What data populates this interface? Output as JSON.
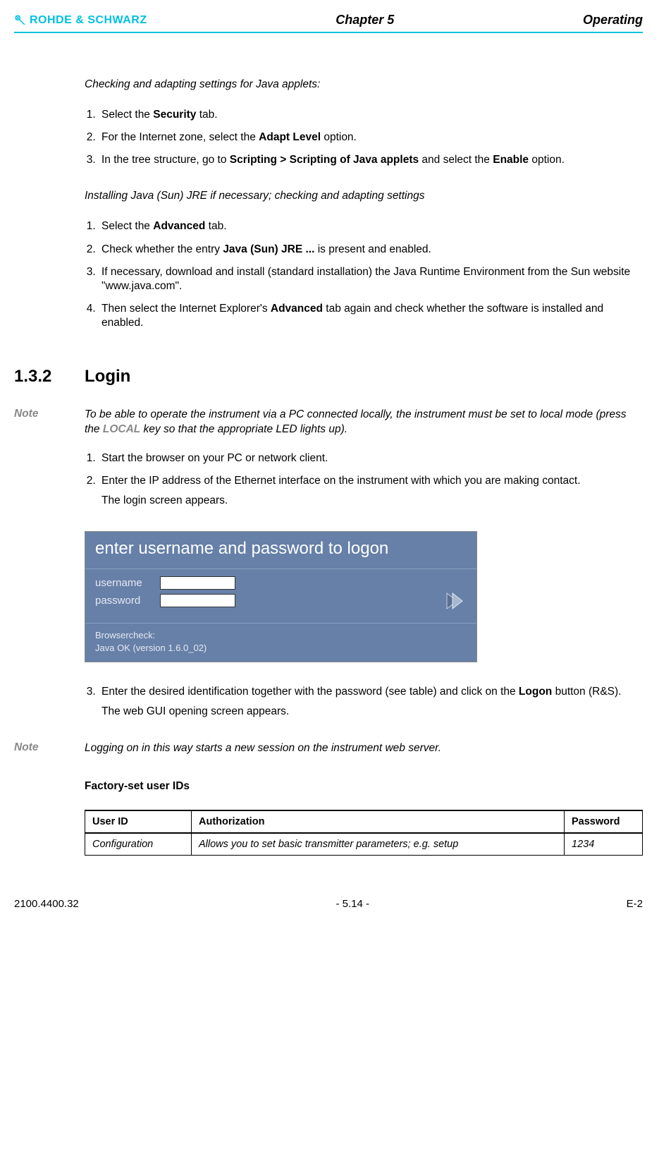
{
  "header": {
    "brand": "ROHDE & SCHWARZ",
    "chapter": "Chapter 5",
    "operating": "Operating"
  },
  "section1": {
    "heading": "Checking and adapting settings for Java applets:",
    "step1_pre": "Select the ",
    "step1_bold": "Security",
    "step1_post": " tab.",
    "step2_pre": "For the Internet zone, select the ",
    "step2_bold": "Adapt Level",
    "step2_post": " option.",
    "step3_pre": "In the tree structure, go to ",
    "step3_bold1": "Scripting > Scripting of Java applets",
    "step3_mid": " and select the ",
    "step3_bold2": "Enable",
    "step3_post": " option."
  },
  "section2": {
    "heading": "Installing Java (Sun) JRE if necessary; checking and adapting settings",
    "step1_pre": "Select the ",
    "step1_bold": "Advanced",
    "step1_post": " tab.",
    "step2_pre": "Check whether the entry ",
    "step2_bold": "Java (Sun) JRE ...",
    "step2_post": " is present and enabled.",
    "step3": "If necessary, download and install (standard installation) the Java Runtime Environment from the Sun website \"www.java.com\".",
    "step4_pre": "Then select the Internet Explorer's ",
    "step4_bold": "Advanced",
    "step4_post": " tab again and check whether the software is installed and enabled."
  },
  "login": {
    "num": "1.3.2",
    "title": "Login",
    "note_label": "Note",
    "note_pre": "To be able to operate the instrument via a PC connected locally, the instrument must be set to local mode (press the ",
    "note_key": "LOCAL",
    "note_post": " key so that the appropriate LED lights up).",
    "step1": "Start the browser on your PC or network client.",
    "step2": "Enter the IP address of the Ethernet interface on the instrument with which you are making contact.",
    "step2_result": "The login screen appears.",
    "screenshot": {
      "title": "enter username and password to logon",
      "username_label": "username",
      "password_label": "password",
      "browsercheck_label": "Browsercheck:",
      "browsercheck_value": "Java OK (version 1.6.0_02)"
    },
    "step3_pre": "Enter the desired identification together with the password (see table) and click on the ",
    "step3_bold": "Logon",
    "step3_post": " button (R&S).",
    "step3_result": "The web GUI opening screen appears.",
    "note2_label": "Note",
    "note2_text": "Logging on in this way starts a new session on the instrument web server."
  },
  "factory": {
    "heading": "Factory-set user IDs",
    "headers": {
      "userid": "User ID",
      "auth": "Authorization",
      "password": "Password"
    },
    "rows": [
      {
        "userid": "Configuration",
        "auth": "Allows you to set basic transmitter parameters; e.g. setup",
        "password": "1234"
      }
    ]
  },
  "footer": {
    "left": "2100.4400.32",
    "center": "- 5.14 -",
    "right": "E-2"
  }
}
